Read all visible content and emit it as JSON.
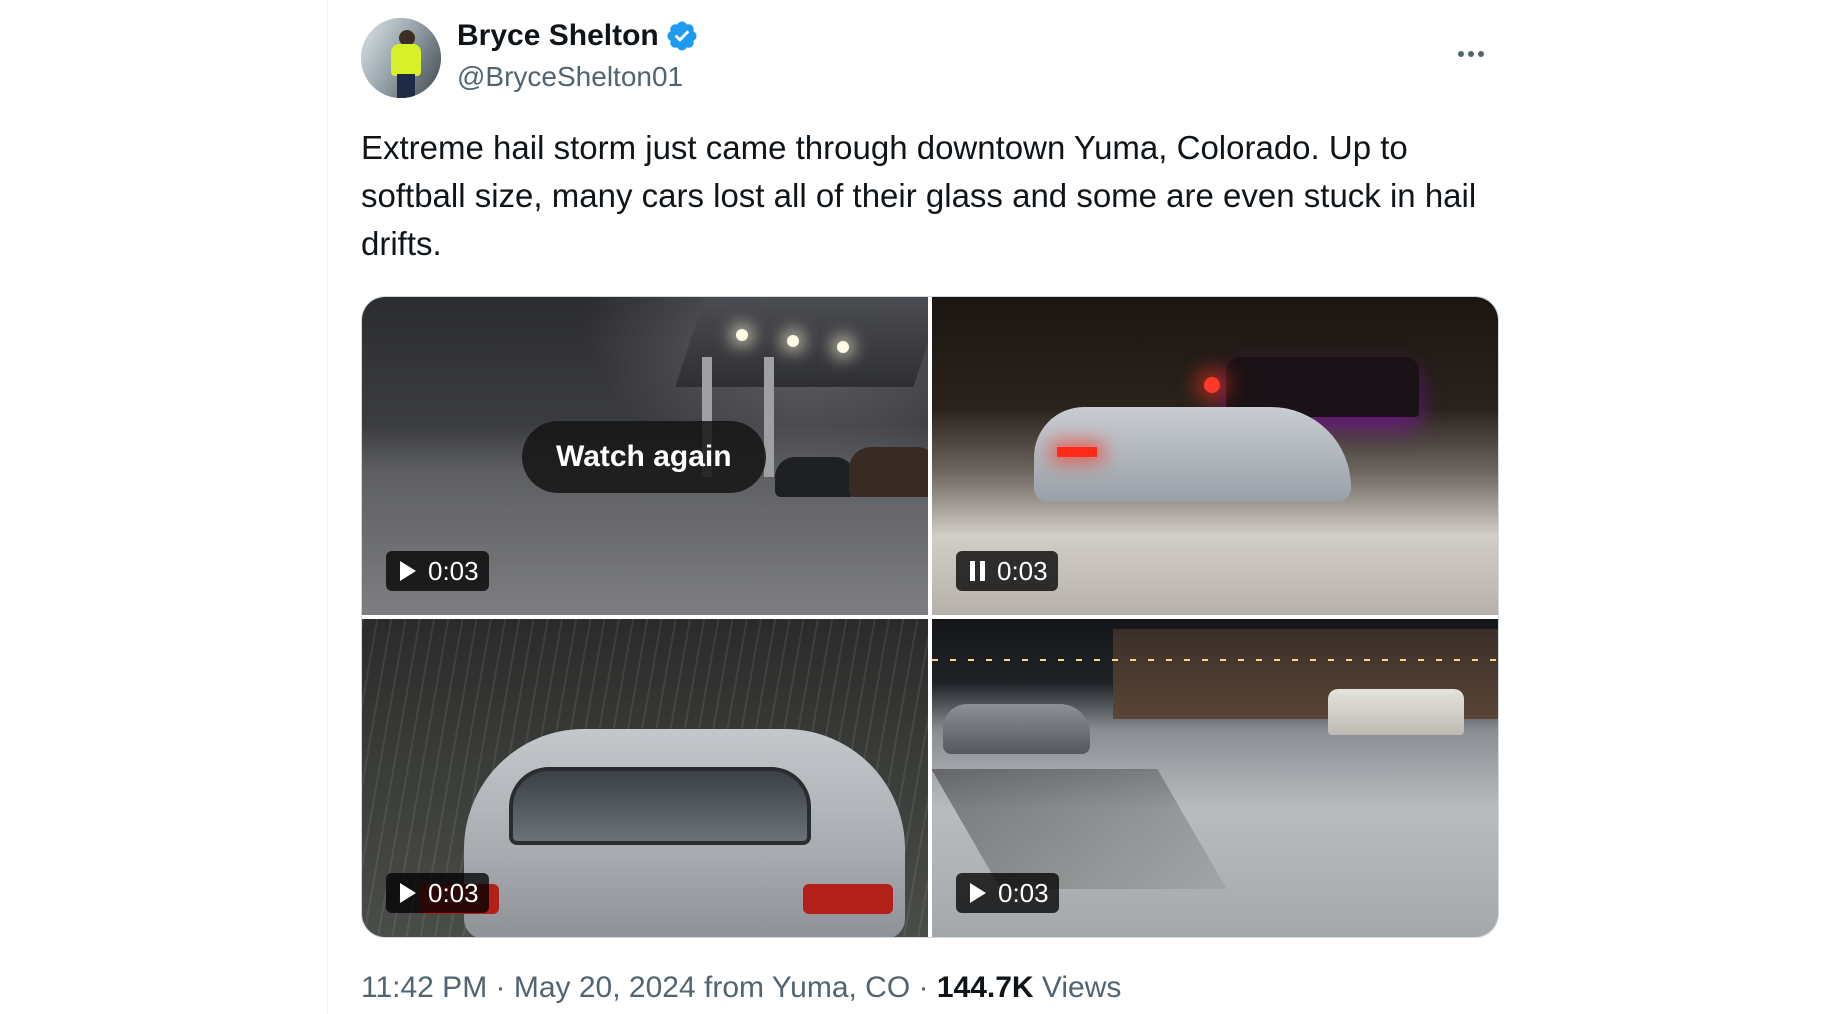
{
  "user": {
    "display_name": "Bryce Shelton",
    "handle": "@BryceShelton01",
    "verified": true,
    "verified_color": "#1d9bf0"
  },
  "tweet": {
    "text": "Extreme hail storm just came through downtown Yuma, Colorado. Up to softball size, many cars lost all of their glass and some are even stuck in hail drifts."
  },
  "media": [
    {
      "duration": "0:03",
      "state": "play",
      "overlay": "Watch again"
    },
    {
      "duration": "0:03",
      "state": "pause"
    },
    {
      "duration": "0:03",
      "state": "play"
    },
    {
      "duration": "0:03",
      "state": "play"
    }
  ],
  "footer": {
    "time": "11:42 PM",
    "sep1": " · ",
    "date": "May 20, 2024",
    "location": " from Yuma, CO",
    "sep2": " · ",
    "views_count": "144.7K",
    "views_label": " Views"
  },
  "colors": {
    "text_primary": "#0f1419",
    "text_secondary": "#536471",
    "border": "#cfd9de"
  },
  "icons": {
    "more": "more-horizontal-icon",
    "verified": "verified-badge-icon",
    "play": "play-icon",
    "pause": "pause-icon"
  }
}
